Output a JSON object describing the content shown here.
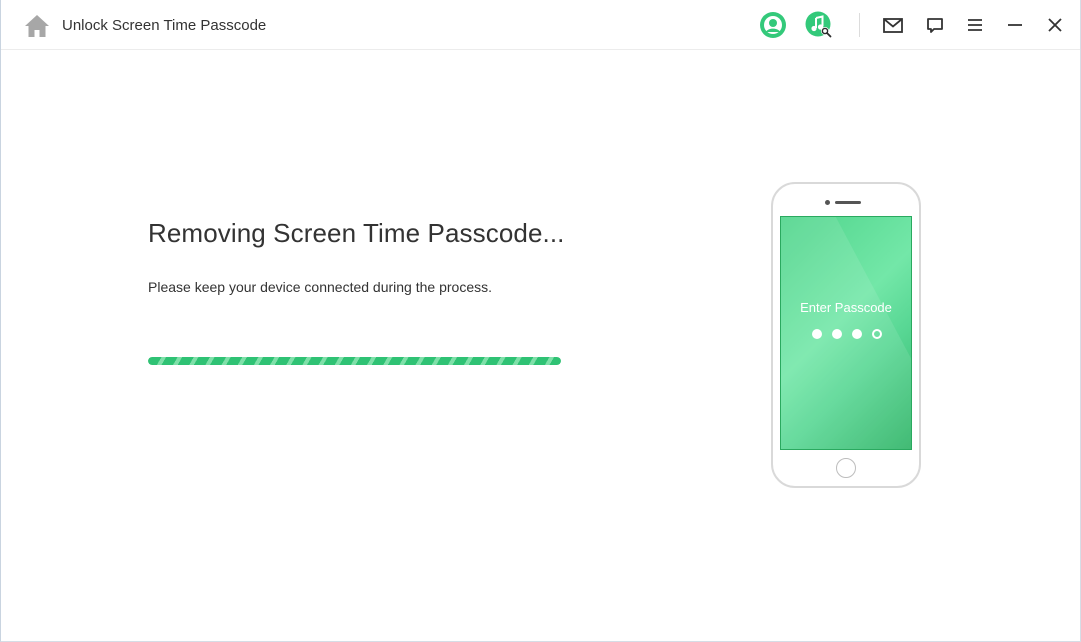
{
  "window": {
    "title": "Unlock Screen Time Passcode"
  },
  "titlebar": {
    "icons": {
      "home": "home-icon",
      "account": "account-icon",
      "music_search": "music-search-icon",
      "mail": "mail-icon",
      "feedback": "feedback-icon",
      "menu": "menu-icon",
      "minimize": "minimize-icon",
      "close": "close-icon"
    }
  },
  "colors": {
    "accent": "#33c97a",
    "icon_gray": "#333333",
    "home_icon": "#a7a7a7"
  },
  "main": {
    "heading": "Removing Screen Time Passcode...",
    "subtext": "Please keep your device connected during the process.",
    "progress": 1.0
  },
  "phone": {
    "label": "Enter Passcode",
    "passcode_dots": [
      true,
      true,
      true,
      false
    ]
  }
}
